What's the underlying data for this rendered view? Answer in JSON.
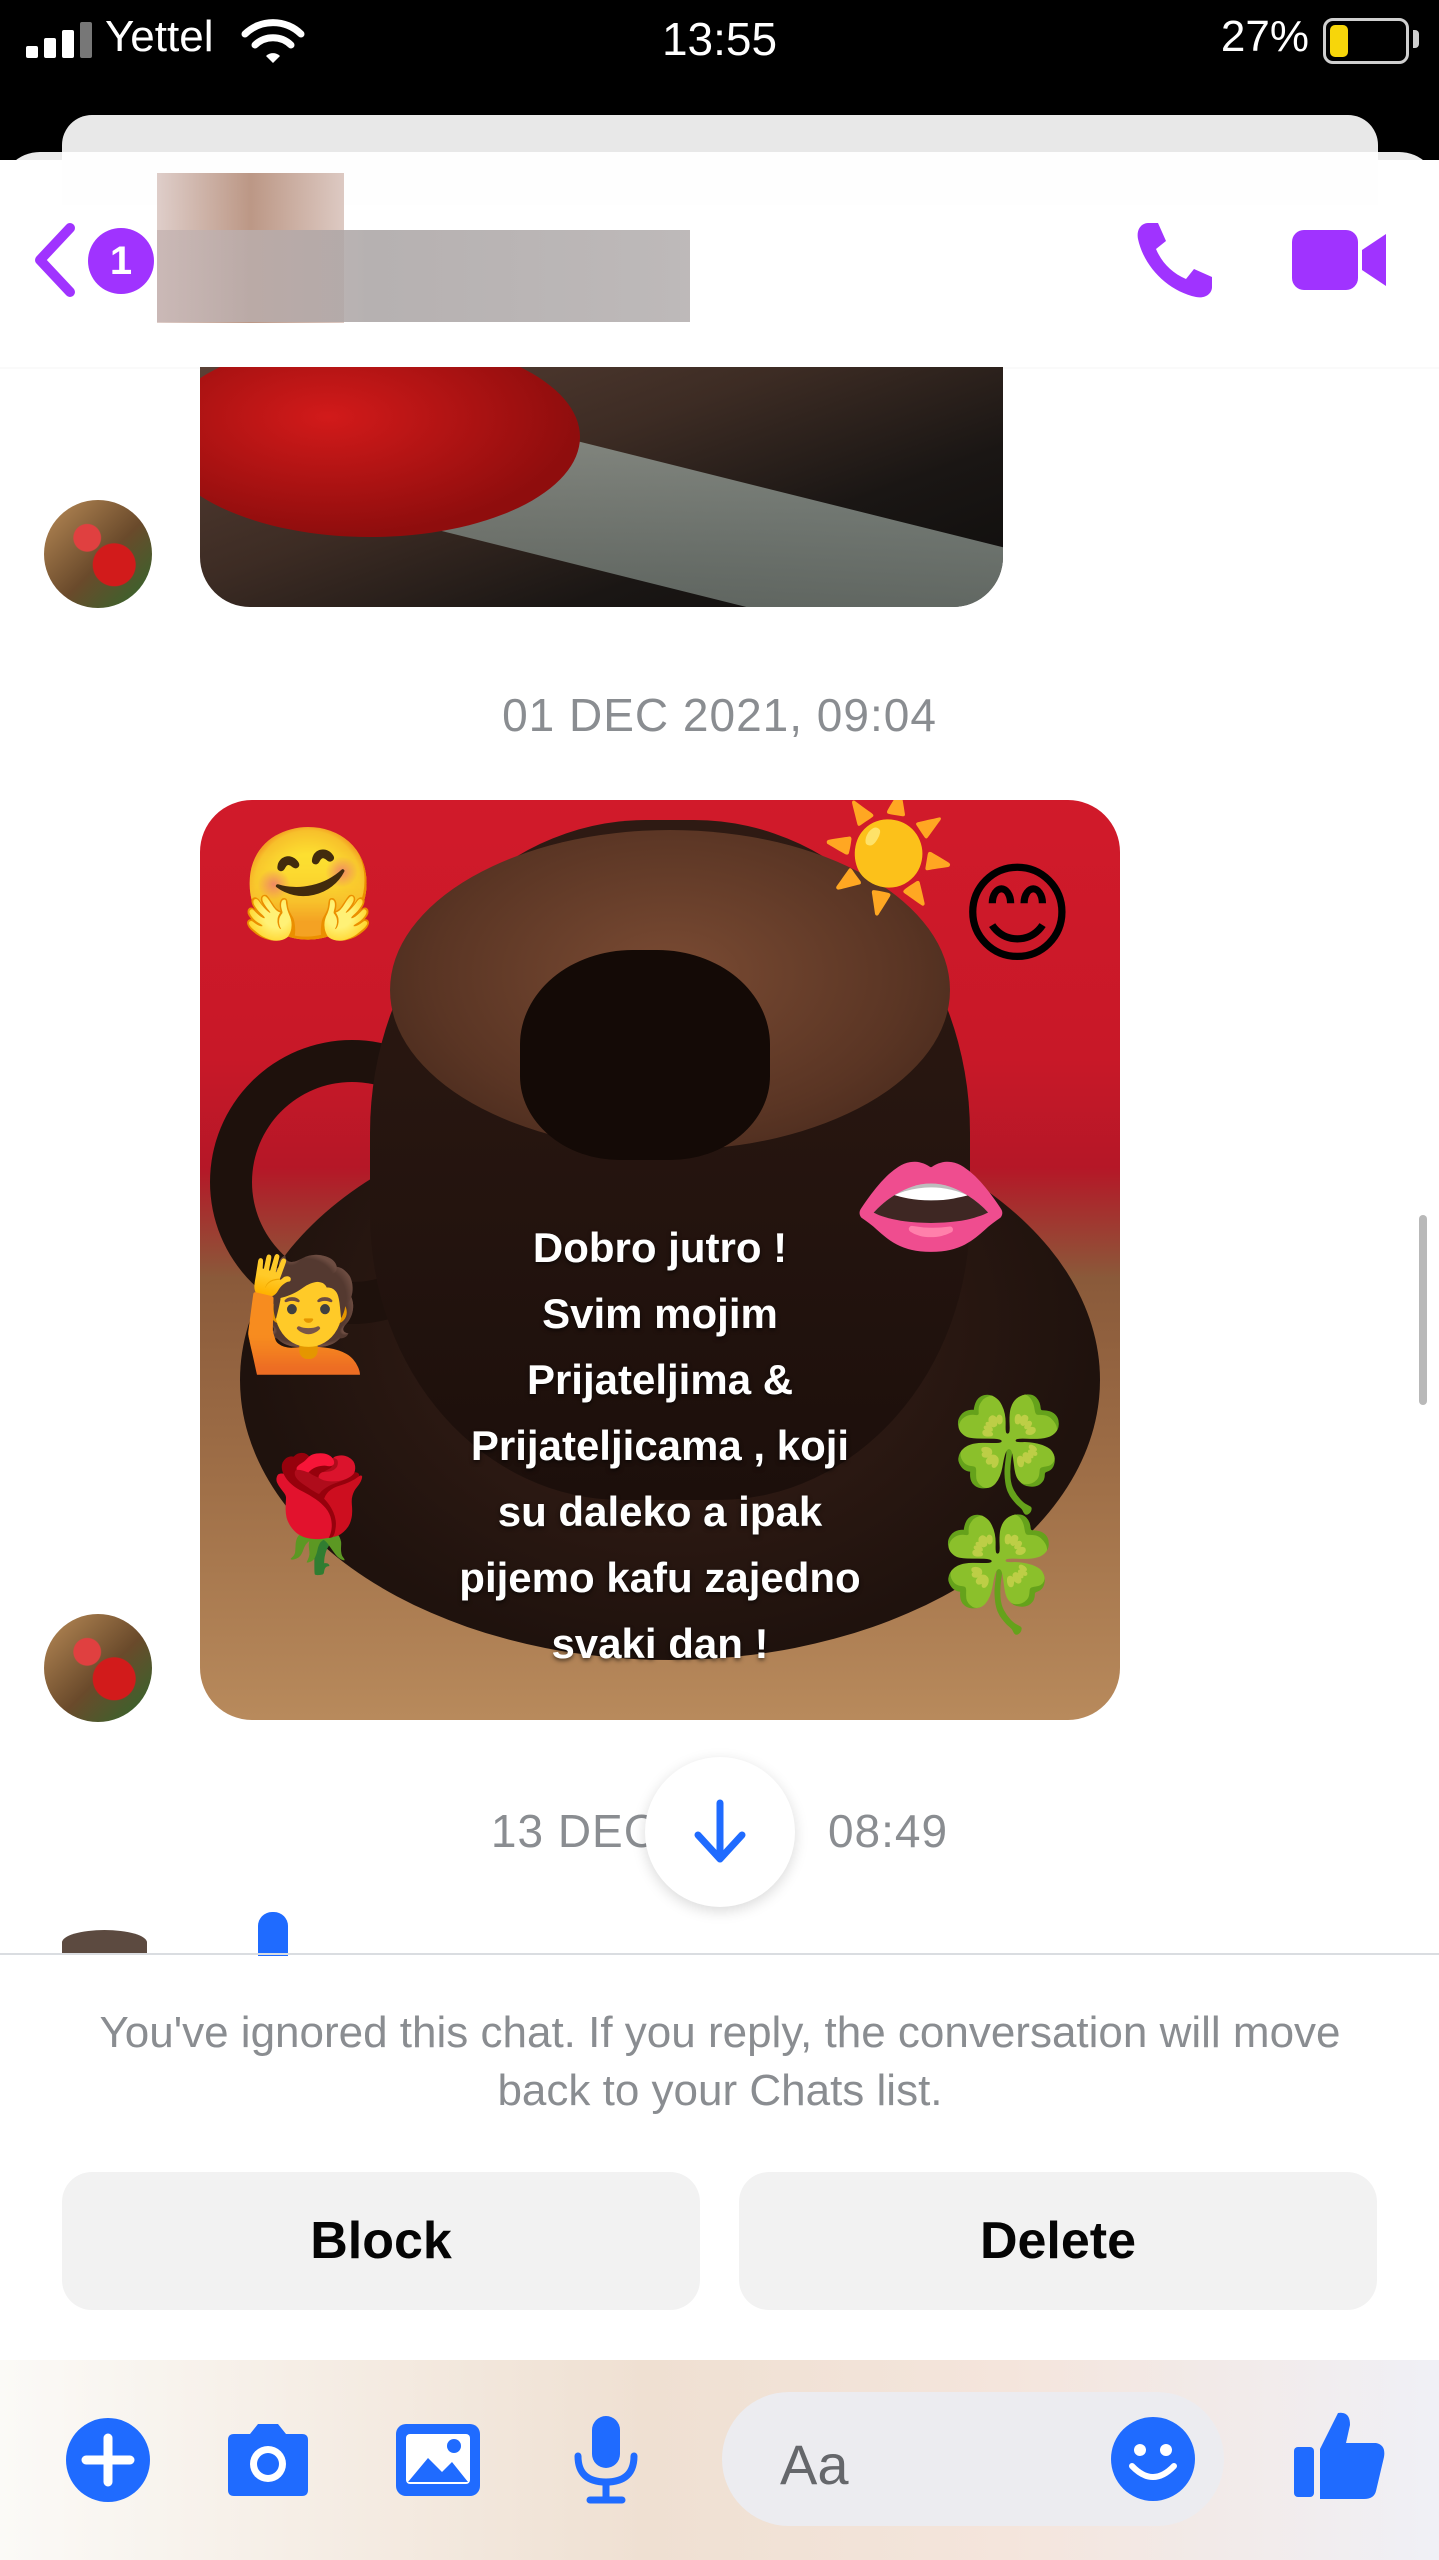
{
  "status_bar": {
    "carrier": "Yettel",
    "time": "13:55",
    "battery_percent": "27%",
    "battery_level": 0.27
  },
  "header": {
    "back_badge_count": "1",
    "accent_color": "#a033ff",
    "icons": [
      "chevron-left-icon",
      "phone-icon",
      "video-camera-icon"
    ]
  },
  "messages": {
    "timestamp_1": "01 DEC 2021, 09:04",
    "image_text": "Dobro jutro !\nSvim mojim\nPrijateljima &\nPrijateljicama , koji\nsu daleko a ipak\npijemo kafu  zajedno\nsvaki dan !",
    "timestamp_2_left": "13 DEC",
    "timestamp_2_right": "08:49"
  },
  "notice": {
    "text": "You've ignored this chat. If you reply, the conversation will move back to your Chats list.",
    "block_label": "Block",
    "delete_label": "Delete"
  },
  "composer": {
    "placeholder": "Aa",
    "icons": [
      "plus-icon",
      "camera-icon",
      "image-icon",
      "microphone-icon",
      "emoji-icon",
      "thumbs-up-icon"
    ],
    "accent_color": "#1f6bff"
  }
}
